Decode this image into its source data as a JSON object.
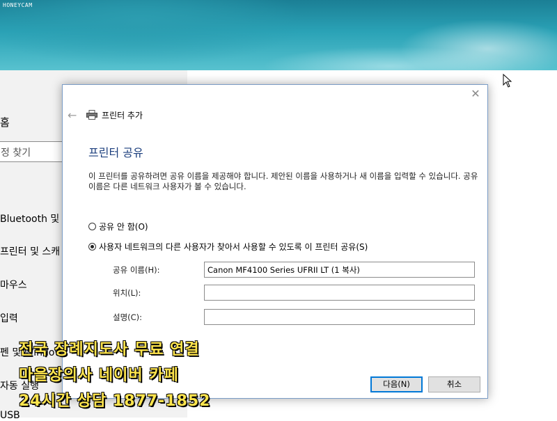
{
  "watermark": "HONEYCAM",
  "settings": {
    "home": "홈",
    "search_placeholder": "정 찾기",
    "items": [
      "Bluetooth 및",
      "프린터 및 스캐",
      "마우스",
      "입력",
      "펜 및 Window",
      "자동 실행",
      "USB"
    ]
  },
  "dialog": {
    "title": "프린터 추가",
    "heading": "프린터 공유",
    "description": "이 프린터를 공유하려면 공유 이름을 제공해야 합니다. 제안된 이름을 사용하거나 새 이름을 입력할 수 있습니다. 공유 이름은 다른 네트워크 사용자가 볼 수 있습니다.",
    "radio_no_share": "공유 안 함(O)",
    "radio_share": "사용자 네트워크의 다른 사용자가 찾아서 사용할 수 있도록 이 프린터 공유(S)",
    "share_name_label": "공유 이름(H):",
    "share_name_value": "Canon MF4100 Series UFRII LT (1 복사)",
    "location_label": "위치(L):",
    "location_value": "",
    "comment_label": "설명(C):",
    "comment_value": "",
    "next_button": "다음(N)",
    "cancel_button": "취소"
  },
  "promo": {
    "line1": "전국 장례지도사 무료 연결",
    "line2": "마을장의사 네이버 카페",
    "line3": "24시간 상담 1877-1852"
  },
  "colors": {
    "accent": "#0078d7",
    "heading": "#1a3d7c",
    "promo_text": "#ffe54d"
  }
}
